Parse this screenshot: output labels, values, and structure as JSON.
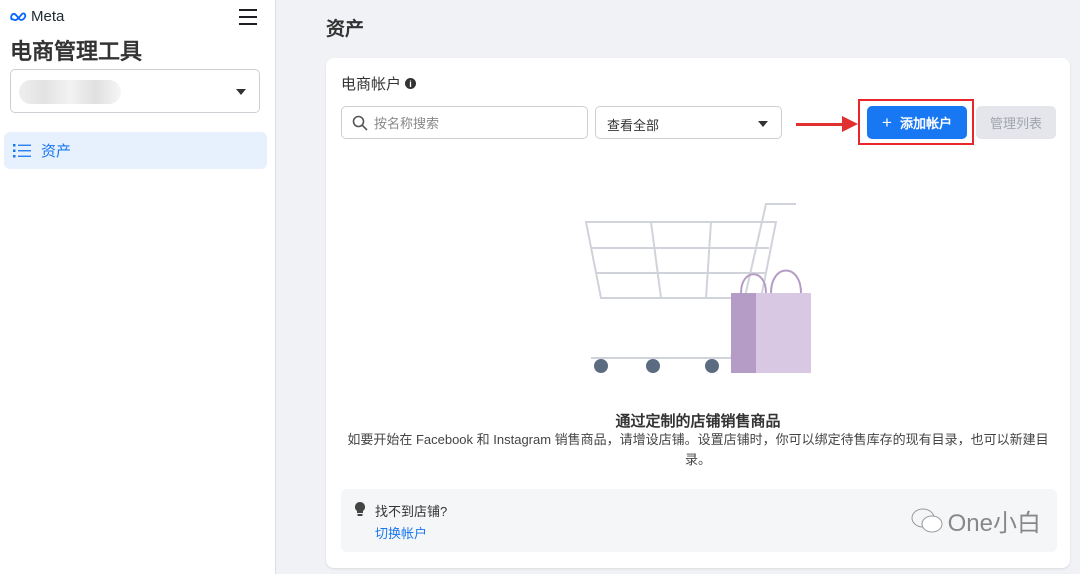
{
  "sidebar": {
    "brand": "Meta",
    "app_title": "电商管理工具",
    "nav": [
      {
        "label": "资产"
      }
    ]
  },
  "main": {
    "page_title": "资产",
    "card_title": "电商帐户",
    "search_placeholder": "按名称搜索",
    "filter_value": "查看全部",
    "add_button": "添加帐户",
    "manage_button": "管理列表",
    "empty_title": "通过定制的店铺销售商品",
    "empty_desc": "如要开始在 Facebook 和 Instagram 销售商品，请增设店铺。设置店铺时，你可以绑定待售库存的现有目录，也可以新建目录。",
    "tip_title": "找不到店铺?",
    "tip_link": "切换帐户",
    "watermark": "One小白"
  },
  "colors": {
    "accent": "#1877f2",
    "highlight": "#e8262c"
  }
}
